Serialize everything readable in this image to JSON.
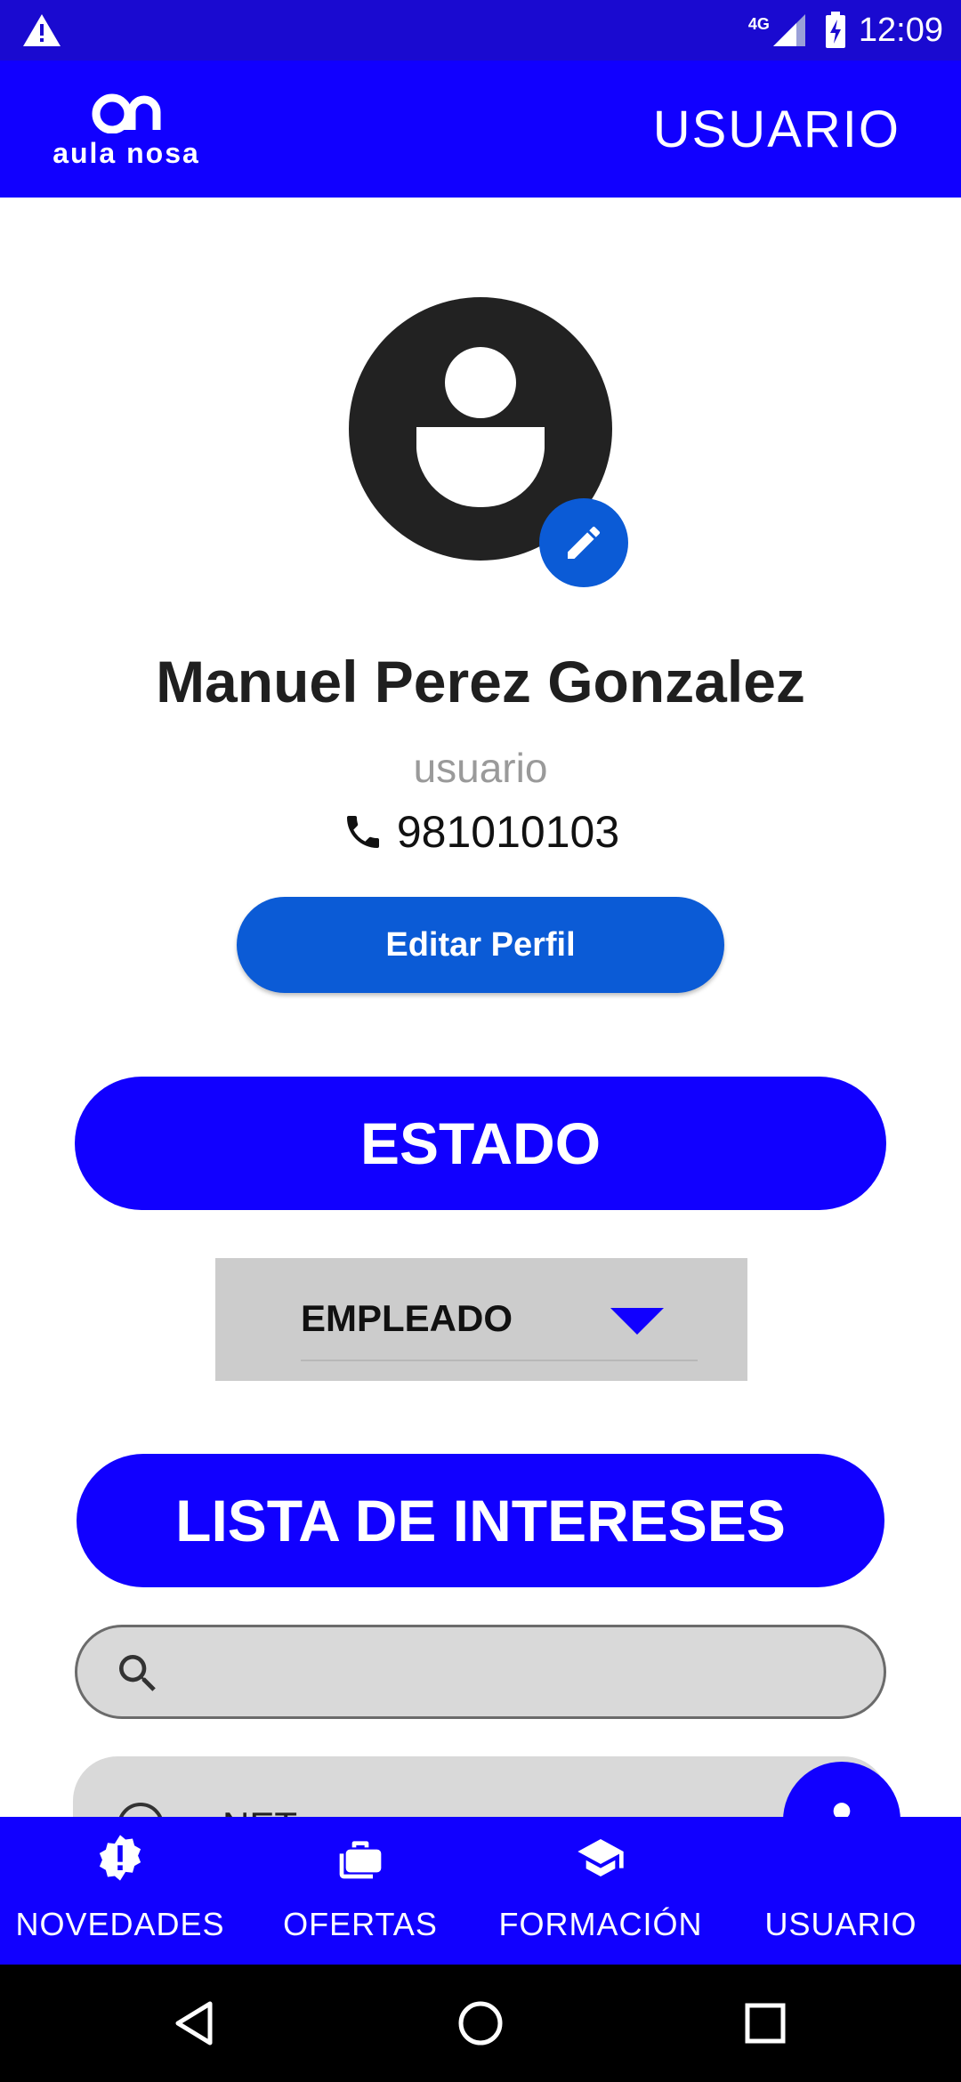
{
  "status_bar": {
    "network": "4G",
    "time": "12:09"
  },
  "app_bar": {
    "logo_text": "aula nosa",
    "title": "USUARIO"
  },
  "profile": {
    "name": "Manuel Perez Gonzalez",
    "role": "usuario",
    "phone": "981010103",
    "edit_button": "Editar Perfil"
  },
  "estado": {
    "header": "ESTADO",
    "selected": "EMPLEADO"
  },
  "intereses": {
    "header": "LISTA DE INTERESES",
    "search_placeholder": "",
    "items": [
      {
        "label": "NET"
      }
    ]
  },
  "bottom_nav": {
    "items": [
      {
        "label": "NOVEDADES",
        "icon": "alert-badge-icon"
      },
      {
        "label": "OFERTAS",
        "icon": "briefcase-icon"
      },
      {
        "label": "FORMACIÓN",
        "icon": "graduation-cap-icon"
      },
      {
        "label": "USUARIO",
        "icon": "person-icon"
      }
    ]
  },
  "colors": {
    "status_bar": "#1a0ad0",
    "primary": "#1100ff",
    "accent": "#0b5bd6",
    "avatar": "#222222",
    "dropdown": "#cccccc",
    "search": "#d9d9d9"
  }
}
